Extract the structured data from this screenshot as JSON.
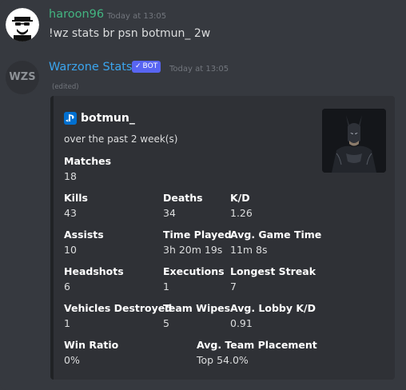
{
  "message1": {
    "username": "haroon96",
    "username_color": "#43b581",
    "timestamp": "Today at 13:05",
    "content": "!wz stats br psn botmun_ 2w"
  },
  "message2": {
    "username": "Warzone Stats",
    "username_color": "#3ba5ee",
    "avatar_text": "WZS",
    "bot_badge": "BOT",
    "timestamp": "Today at 13:05",
    "edited": "(edited)",
    "embed": {
      "author_icon": "playstation-icon",
      "author": "botmun_",
      "description": "over the past 2 week(s)",
      "fields": [
        {
          "name": "Matches",
          "value": "18"
        },
        {
          "name": "Kills",
          "value": "43"
        },
        {
          "name": "Deaths",
          "value": "34"
        },
        {
          "name": "K/D",
          "value": "1.26"
        },
        {
          "name": "Assists",
          "value": "10"
        },
        {
          "name": "Time Played",
          "value": "3h 20m 19s"
        },
        {
          "name": "Avg. Game Time",
          "value": "11m 8s"
        },
        {
          "name": "Headshots",
          "value": "6"
        },
        {
          "name": "Executions",
          "value": "1"
        },
        {
          "name": "Longest Streak",
          "value": "7"
        },
        {
          "name": "Vehicles Destroyed",
          "value": "1"
        },
        {
          "name": "Team Wipes",
          "value": "5"
        },
        {
          "name": "Avg. Lobby K/D",
          "value": "0.91"
        },
        {
          "name": "Win Ratio",
          "value": "0%"
        },
        {
          "name": "Avg. Team Placement",
          "value": "Top 54.0%"
        }
      ]
    }
  }
}
